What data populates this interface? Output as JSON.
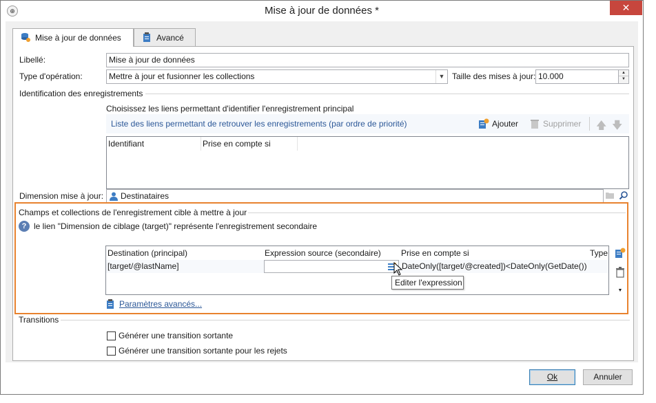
{
  "window": {
    "title": "Mise à jour de données *",
    "close_glyph": "✕",
    "app_icon_glyph": "⊕"
  },
  "tabs": [
    {
      "label": "Mise à jour de données",
      "icon": "database-update-icon",
      "active": true
    },
    {
      "label": "Avancé",
      "icon": "clipboard-icon",
      "active": false
    }
  ],
  "form": {
    "libelle_label": "Libellé:",
    "libelle_value": "Mise à jour de données",
    "type_op_label": "Type d'opération:",
    "type_op_value": "Mettre à jour et fusionner les collections",
    "taille_label": "Taille des mises à jour:",
    "taille_value": "10.000"
  },
  "identification": {
    "section_title": "Identification des enregistrements",
    "instruction": "Choisissez les liens permettant d'identifier l'enregistrement principal",
    "list_title": "Liste des liens permettant de retrouver les enregistrements (par ordre de priorité)",
    "add_label": "Ajouter",
    "delete_label": "Supprimer",
    "columns": [
      "Identifiant",
      "Prise en compte si"
    ]
  },
  "dimension": {
    "label": "Dimension mise à jour:",
    "value": "Destinataires"
  },
  "champs": {
    "section_title": "Champs et collections de l'enregistrement cible à mettre à jour",
    "info_text": "le lien \"Dimension de ciblage (target)\" représente l'enregistrement secondaire",
    "columns": [
      "Destination (principal)",
      "Expression source (secondaire)",
      "Prise en compte si",
      "Type"
    ],
    "rows": [
      {
        "destination": "[target/@lastName]",
        "expression": "",
        "condition": "DateOnly([target/@created])<DateOnly(GetDate())",
        "type": ""
      }
    ],
    "tooltip": "Editer l'expression",
    "advanced_link": "Paramètres avancés..."
  },
  "transitions": {
    "section_title": "Transitions",
    "checkbox1": "Générer une transition sortante",
    "checkbox2": "Générer une transition sortante pour les rejets"
  },
  "buttons": {
    "ok": "Ok",
    "cancel": "Annuler"
  },
  "colors": {
    "highlight": "#e8822e",
    "link": "#2b5797",
    "close": "#c7463d"
  }
}
